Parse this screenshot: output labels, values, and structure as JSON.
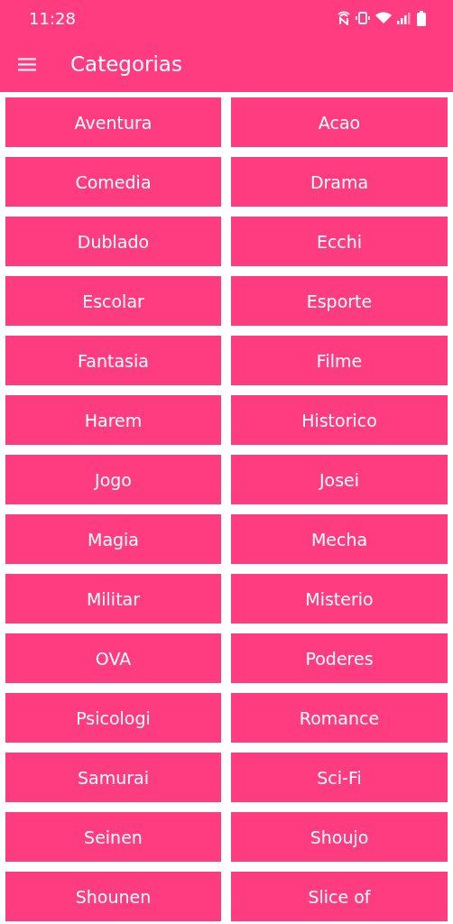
{
  "status_bar": {
    "time": "11:28"
  },
  "toolbar": {
    "title": "Categorias"
  },
  "categories": [
    "Aventura",
    "Acao",
    "Comedia",
    "Drama",
    "Dublado",
    "Ecchi",
    "Escolar",
    "Esporte",
    "Fantasia",
    "Filme",
    "Harem",
    "Historico",
    "Jogo",
    "Josei",
    "Magia",
    "Mecha",
    "Militar",
    "Misterio",
    "OVA",
    "Poderes",
    "Psicologi",
    "Romance",
    "Samurai",
    "Sci-Fi",
    "Seinen",
    "Shoujo",
    "Shounen",
    "Slice of"
  ]
}
